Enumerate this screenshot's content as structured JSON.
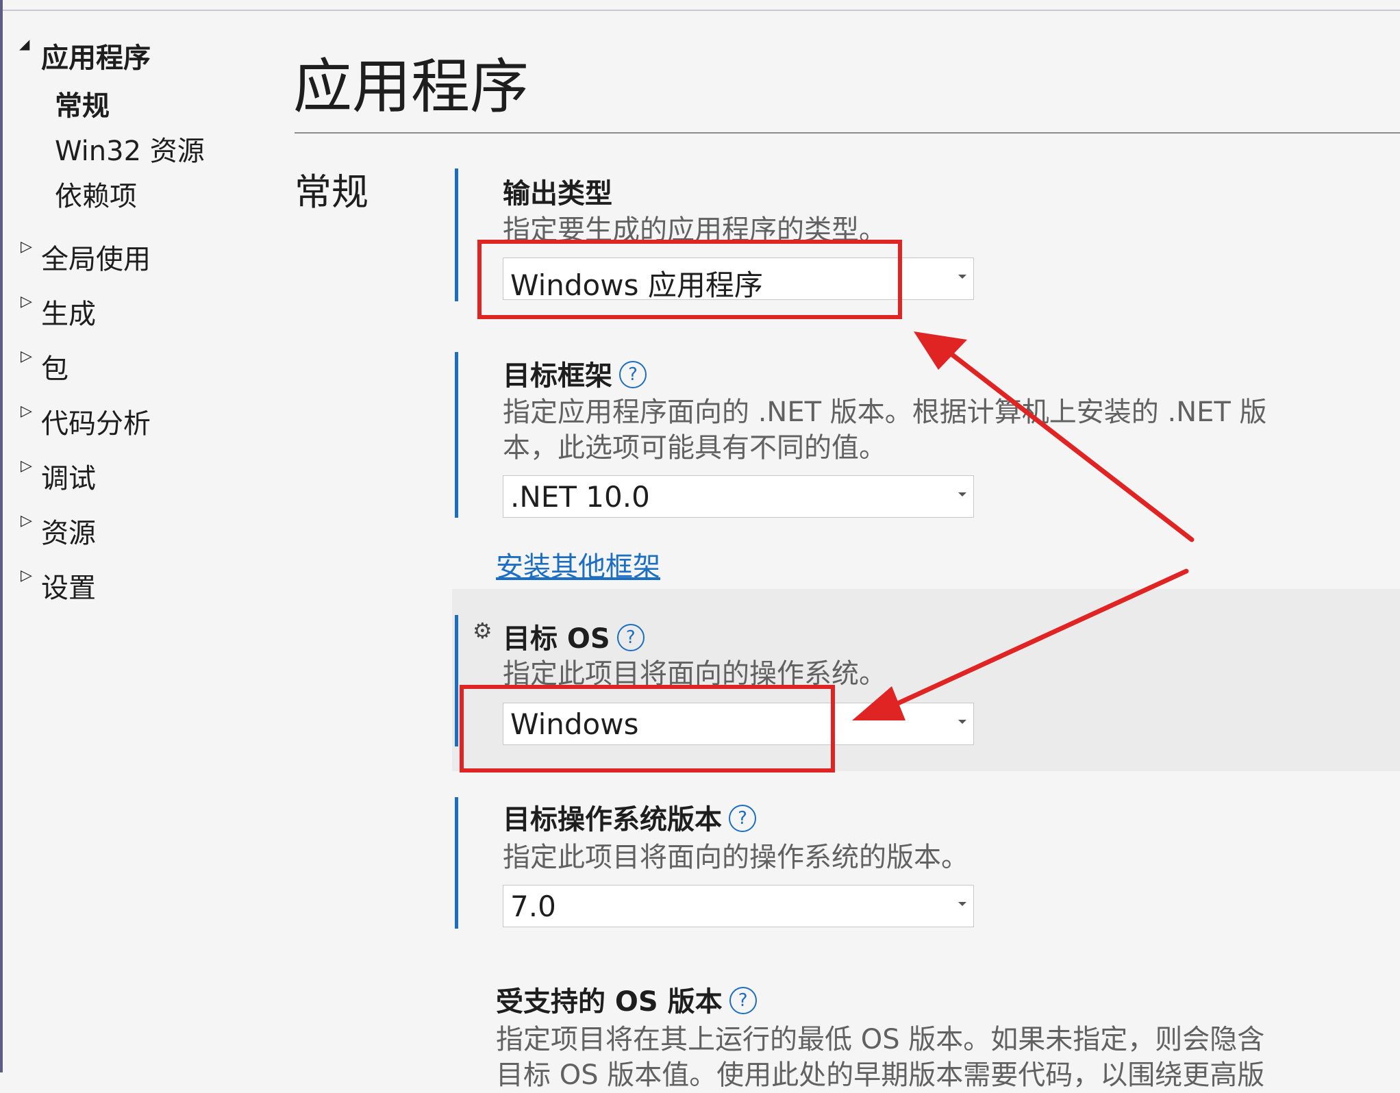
{
  "sidebar": {
    "items": [
      {
        "label": "应用程序",
        "expanded": true
      },
      {
        "label": "常规",
        "selected": true
      },
      {
        "label": "Win32 资源"
      },
      {
        "label": "依赖项"
      },
      {
        "label": "全局使用"
      },
      {
        "label": "生成"
      },
      {
        "label": "包"
      },
      {
        "label": "代码分析"
      },
      {
        "label": "调试"
      },
      {
        "label": "资源"
      },
      {
        "label": "设置"
      }
    ]
  },
  "page": {
    "title": "应用程序",
    "section": "常规"
  },
  "settings": {
    "output_type": {
      "label": "输出类型",
      "description": "指定要生成的应用程序的类型。",
      "value": "Windows 应用程序"
    },
    "target_framework": {
      "label": "目标框架",
      "description_line1": "指定应用程序面向的 .NET 版本。根据计算机上安装的 .NET 版",
      "description_line2": "本，此选项可能具有不同的值。",
      "value": ".NET 10.0",
      "link": "安装其他框架"
    },
    "target_os": {
      "label": "目标 OS",
      "description": "指定此项目将面向的操作系统。",
      "value": "Windows"
    },
    "target_os_version": {
      "label": "目标操作系统版本",
      "description": "指定此项目将面向的操作系统的版本。",
      "value": "7.0"
    },
    "supported_os_version": {
      "label": "受支持的 OS 版本",
      "description_line1": "指定项目将在其上运行的最低 OS 版本。如果未指定，则会隐含",
      "description_line2": "目标 OS 版本值。使用此处的早期版本需要代码，以围绕更高版"
    }
  },
  "icons": {
    "help": "?",
    "gear": "⚙",
    "caret_expanded": "◢",
    "caret_collapsed": "▷"
  },
  "colors": {
    "accent": "#1b6ec2",
    "annotation": "#e02424"
  }
}
